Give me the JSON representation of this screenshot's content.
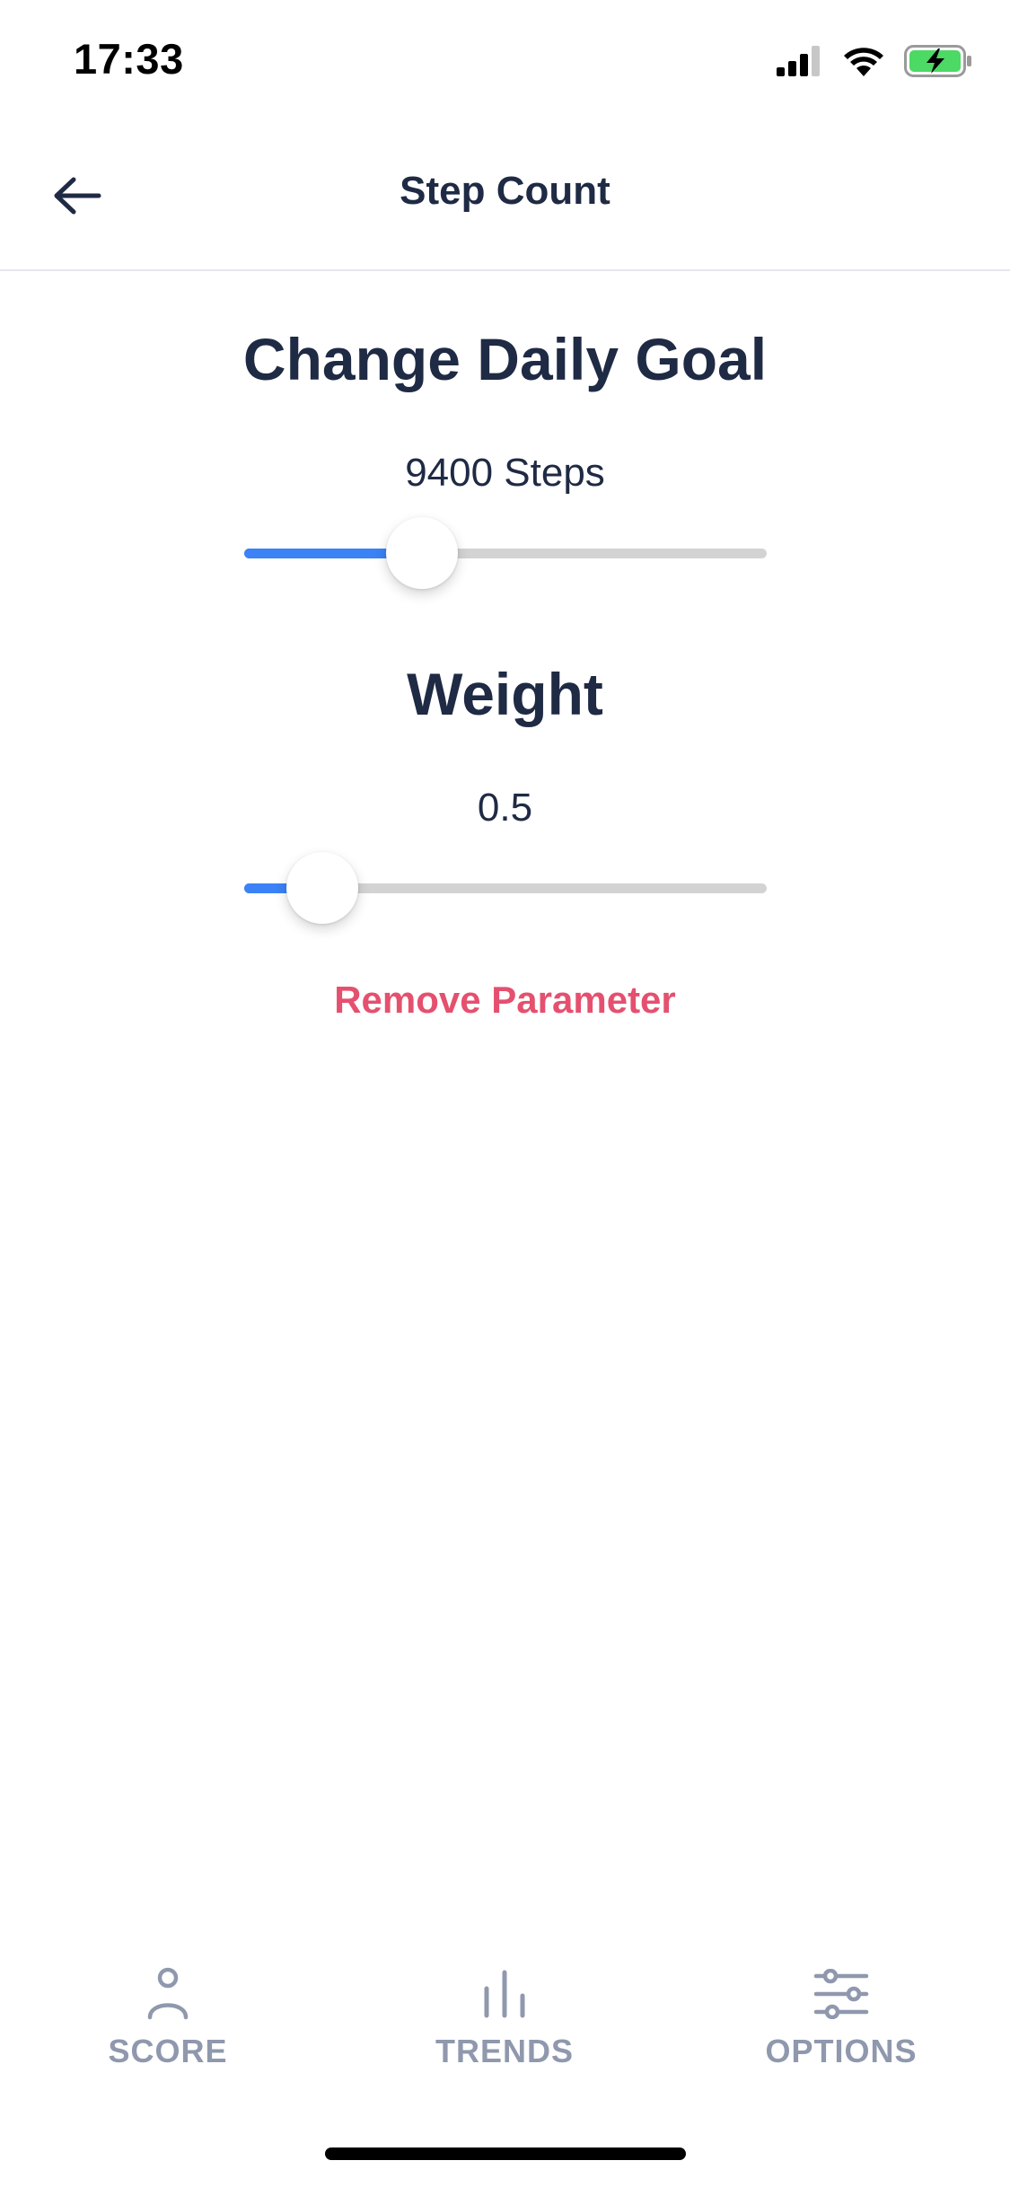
{
  "status_bar": {
    "time": "17:33",
    "icons": [
      "cellular-signal-icon",
      "wifi-icon",
      "battery-charging-icon"
    ],
    "battery_color": "#4cd964"
  },
  "header": {
    "back_icon": "arrow-left-icon",
    "title": "Step Count"
  },
  "goal": {
    "title": "Change Daily Goal",
    "value_label": "9400 Steps",
    "slider_fraction": 0.34
  },
  "weight": {
    "title": "Weight",
    "value_label": "0.5",
    "slider_fraction": 0.15
  },
  "actions": {
    "remove_label": "Remove Parameter"
  },
  "tabs": [
    {
      "label": "SCORE",
      "icon": "person-icon"
    },
    {
      "label": "TRENDS",
      "icon": "bar-chart-icon"
    },
    {
      "label": "OPTIONS",
      "icon": "sliders-icon"
    }
  ],
  "colors": {
    "accent": "#3b82f6",
    "destructive": "#e5506f",
    "text_primary": "#1f2a44",
    "tab_inactive": "#8f98ad",
    "track": "#d3d3d3"
  }
}
